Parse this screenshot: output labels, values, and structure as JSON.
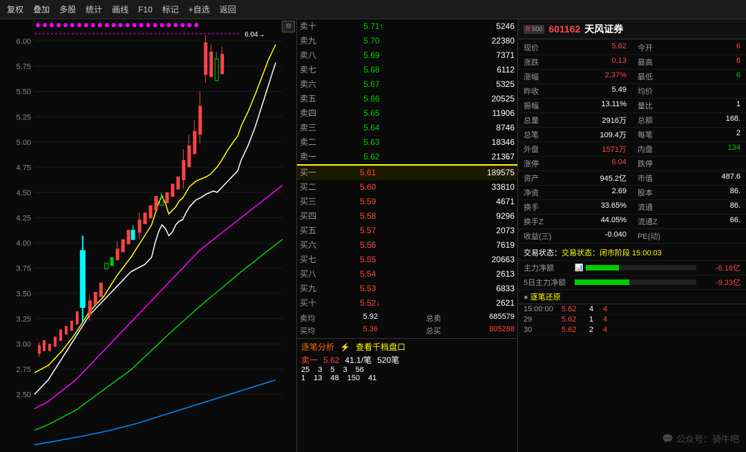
{
  "toolbar": {
    "buttons": [
      "复权",
      "叠加",
      "多股",
      "统计",
      "画线",
      "F10",
      "标记",
      "+自选",
      "返回"
    ]
  },
  "chart": {
    "price_label": "6.04",
    "y_axis_labels": [
      "6.00",
      "5.75",
      "5.50",
      "5.25",
      "5.00",
      "4.75",
      "4.50",
      "4.25",
      "4.00",
      "3.75",
      "3.50",
      "3.25",
      "3.00",
      "2.75",
      "2.50"
    ]
  },
  "order_book": {
    "sell_orders": [
      {
        "label": "卖十",
        "price": "5.71",
        "arrow": "↑",
        "vol": "5246"
      },
      {
        "label": "卖九",
        "price": "5.70",
        "vol": "22380"
      },
      {
        "label": "卖八",
        "price": "5.69",
        "vol": "7371"
      },
      {
        "label": "卖七",
        "price": "5.68",
        "vol": "6112"
      },
      {
        "label": "卖六",
        "price": "5.67",
        "vol": "5325"
      },
      {
        "label": "卖五",
        "price": "5.66",
        "vol": "20525"
      },
      {
        "label": "卖四",
        "price": "5.65",
        "vol": "11906"
      },
      {
        "label": "卖三",
        "price": "5.64",
        "vol": "8746"
      },
      {
        "label": "卖二",
        "price": "5.63",
        "vol": "18346"
      },
      {
        "label": "卖一",
        "price": "5.62",
        "vol": "21367"
      }
    ],
    "buy_orders": [
      {
        "label": "买一",
        "price": "5.61",
        "vol": "189575"
      },
      {
        "label": "买二",
        "price": "5.60",
        "vol": "33810"
      },
      {
        "label": "买三",
        "price": "5.59",
        "vol": "4671"
      },
      {
        "label": "买四",
        "price": "5.58",
        "vol": "9296"
      },
      {
        "label": "买五",
        "price": "5.57",
        "vol": "2073"
      },
      {
        "label": "买六",
        "price": "5.56",
        "vol": "7619"
      },
      {
        "label": "买七",
        "price": "5.55",
        "vol": "20663"
      },
      {
        "label": "买八",
        "price": "5.54",
        "vol": "2613"
      },
      {
        "label": "买九",
        "price": "5.53",
        "vol": "6833"
      },
      {
        "label": "买十",
        "price": "5.52",
        "arrow": "↓",
        "vol": "2621"
      }
    ],
    "sell_avg": "5.92",
    "buy_avg": "5.36",
    "total_sell": "685579",
    "total_buy": "805288"
  },
  "analysis": {
    "label": "逐笔分析",
    "link": "查看千档盘口",
    "sell_label": "卖一",
    "sell_price": "5.62",
    "sell_per_note": "41.1/笔",
    "sell_total": "520笔",
    "row2": [
      {
        "val": "25",
        "color": "white"
      },
      {
        "val": "3",
        "color": "white"
      },
      {
        "val": "5",
        "color": "white"
      },
      {
        "val": "3",
        "color": "white"
      },
      {
        "val": "56",
        "color": "white"
      }
    ],
    "row3": [
      {
        "val": "1",
        "color": "white"
      },
      {
        "val": "13",
        "color": "white"
      },
      {
        "val": "48",
        "color": "white"
      },
      {
        "val": "150",
        "color": "white"
      },
      {
        "val": "41",
        "color": "white"
      }
    ]
  },
  "stock_info": {
    "badge": "R500",
    "code": "601162",
    "name": "天风证券",
    "fields": [
      {
        "key": "现价",
        "val": "5.62",
        "color": "red"
      },
      {
        "key": "今开",
        "val": "6",
        "color": "red"
      },
      {
        "key": "涨跌",
        "val": "0.13",
        "color": "red"
      },
      {
        "key": "最高",
        "val": "6",
        "color": "red"
      },
      {
        "key": "涨幅",
        "val": "2.37%",
        "color": "red"
      },
      {
        "key": "最低",
        "val": "6",
        "color": "green"
      },
      {
        "key": "昨收",
        "val": "5.49",
        "color": "white"
      },
      {
        "key": "均价",
        "val": "",
        "color": "white"
      },
      {
        "key": "振幅",
        "val": "13.11%",
        "color": "white"
      },
      {
        "key": "量比",
        "val": "1",
        "color": "white"
      },
      {
        "key": "总量",
        "val": "2916万",
        "color": "white"
      },
      {
        "key": "总额",
        "val": "168.",
        "color": "white"
      },
      {
        "key": "总笔",
        "val": "109.4万",
        "color": "white"
      },
      {
        "key": "每笔",
        "val": "2",
        "color": "white"
      },
      {
        "key": "外盘",
        "val": "1571万",
        "color": "red"
      },
      {
        "key": "内盘",
        "val": "134",
        "color": "green"
      },
      {
        "key": "涨停",
        "val": "6.04",
        "color": "red"
      },
      {
        "key": "跌停",
        "val": "",
        "color": "green"
      },
      {
        "key": "资产",
        "val": "945.2亿",
        "color": "white"
      },
      {
        "key": "市值",
        "val": "487.6",
        "color": "white"
      },
      {
        "key": "净资",
        "val": "2.69",
        "color": "white"
      },
      {
        "key": "股本",
        "val": "86.",
        "color": "white"
      },
      {
        "key": "换手",
        "val": "33.65%",
        "color": "white"
      },
      {
        "key": "流通",
        "val": "86.",
        "color": "white"
      },
      {
        "key": "换手Z",
        "val": "44.05%",
        "color": "white"
      },
      {
        "key": "流通Z",
        "val": "66.",
        "color": "white"
      },
      {
        "key": "收益(三)",
        "val": "-0.040",
        "color": "white"
      },
      {
        "key": "PE(动)",
        "val": "",
        "color": "white"
      }
    ],
    "status": "交易状态：闭市阶段 15:00:03",
    "flow1_label": "主力净额",
    "flow1_val": "-6.16亿",
    "flow2_label": "5日主力净额",
    "flow2_val": "-9.33亿"
  },
  "ticks": {
    "header": "逐笔还原",
    "rows": [
      {
        "time": "15:00:00",
        "price": "5.62",
        "vol": "4",
        "dir": "4",
        "color": "red"
      },
      {
        "time": "29",
        "price": "5.62",
        "vol": "1",
        "dir": "4",
        "color": "red"
      },
      {
        "time": "30",
        "price": "5.62",
        "vol": "2",
        "dir": "4",
        "color": "red"
      }
    ]
  }
}
